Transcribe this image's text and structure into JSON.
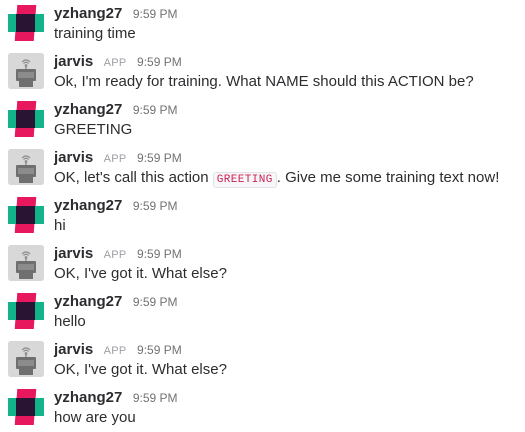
{
  "messages": [
    {
      "author": "yzhang27",
      "is_app": false,
      "time": "9:59 PM",
      "text": "training time"
    },
    {
      "author": "jarvis",
      "is_app": true,
      "app_badge": "APP",
      "time": "9:59 PM",
      "text": "Ok, I'm ready for training. What NAME should this ACTION be?"
    },
    {
      "author": "yzhang27",
      "is_app": false,
      "time": "9:59 PM",
      "text": "GREETING"
    },
    {
      "author": "jarvis",
      "is_app": true,
      "app_badge": "APP",
      "time": "9:59 PM",
      "text_before": "OK, let's call this action ",
      "code": "GREETING",
      "text_after": ". Give me some training text now!"
    },
    {
      "author": "yzhang27",
      "is_app": false,
      "time": "9:59 PM",
      "text": "hi"
    },
    {
      "author": "jarvis",
      "is_app": true,
      "app_badge": "APP",
      "time": "9:59 PM",
      "text": "OK, I've got it. What else?"
    },
    {
      "author": "yzhang27",
      "is_app": false,
      "time": "9:59 PM",
      "text": "hello"
    },
    {
      "author": "jarvis",
      "is_app": true,
      "app_badge": "APP",
      "time": "9:59 PM",
      "text": "OK, I've got it. What else?"
    },
    {
      "author": "yzhang27",
      "is_app": false,
      "time": "9:59 PM",
      "text": "how are you"
    }
  ],
  "icons": {
    "user_avatar": "identicon-avatar",
    "bot_avatar": "robot-icon"
  },
  "colors": {
    "avatar_pink": "#e8185e",
    "avatar_green": "#14b48b",
    "avatar_dark": "#2a1433",
    "bot_avatar_bg": "#d8d8d8",
    "code_text": "#cc2255"
  }
}
